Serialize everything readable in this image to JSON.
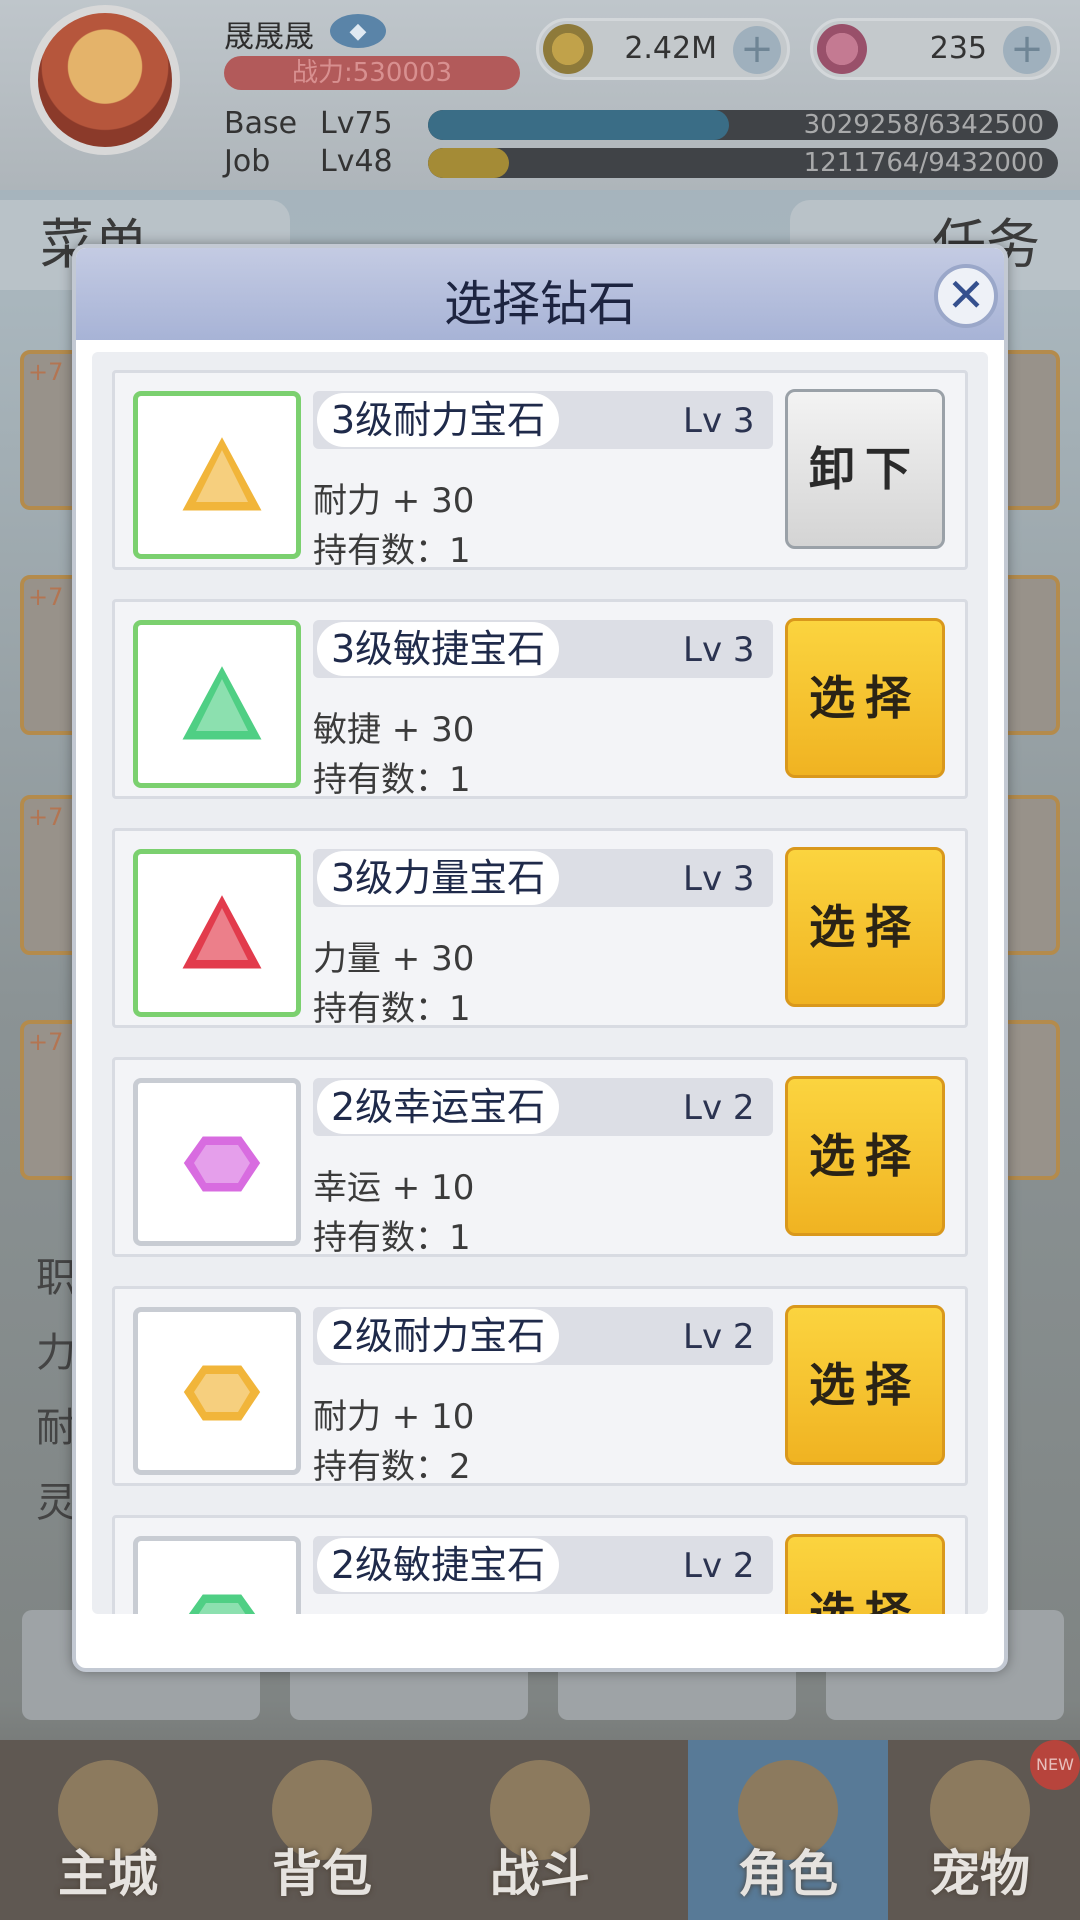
{
  "player": {
    "name": "晟晟晟",
    "power_label": "战力:530003",
    "base_label": "Base",
    "base_level": "Lv75",
    "base_exp": "3029258/6342500",
    "base_exp_fraction": 0.478,
    "job_label": "Job",
    "job_level": "Lv48",
    "job_exp": "1211764/9432000",
    "job_exp_fraction": 0.128
  },
  "currency": {
    "zeny": "2.42M",
    "gems": "235"
  },
  "background": {
    "tab_menu": "菜单",
    "tab_task": "任务",
    "card_plus": "+7",
    "stats": [
      "职",
      "力",
      "耐",
      "灵"
    ]
  },
  "modal": {
    "title": "选择钻石",
    "close_symbol": "✕"
  },
  "gems": [
    {
      "name": "3级耐力宝石",
      "level": "Lv 3",
      "stat": "耐力 + 30",
      "count": "持有数：1",
      "button": "卸下",
      "button_type": "unequip",
      "color": "#f1b53a",
      "shape": "triangle",
      "equipped": true
    },
    {
      "name": "3级敏捷宝石",
      "level": "Lv 3",
      "stat": "敏捷 + 30",
      "count": "持有数：1",
      "button": "选择",
      "button_type": "select",
      "color": "#4fcf84",
      "shape": "triangle",
      "equipped": true
    },
    {
      "name": "3级力量宝石",
      "level": "Lv 3",
      "stat": "力量 + 30",
      "count": "持有数：1",
      "button": "选择",
      "button_type": "select",
      "color": "#e23b4c",
      "shape": "triangle",
      "equipped": true
    },
    {
      "name": "2级幸运宝石",
      "level": "Lv 2",
      "stat": "幸运 + 10",
      "count": "持有数：1",
      "button": "选择",
      "button_type": "select",
      "color": "#d86ce0",
      "shape": "round",
      "equipped": false
    },
    {
      "name": "2级耐力宝石",
      "level": "Lv 2",
      "stat": "耐力 + 10",
      "count": "持有数：2",
      "button": "选择",
      "button_type": "select",
      "color": "#f1b53a",
      "shape": "round",
      "equipped": false
    },
    {
      "name": "2级敏捷宝石",
      "level": "Lv 2",
      "stat": "",
      "count": "",
      "button": "选择",
      "button_type": "select",
      "color": "#4fcf84",
      "shape": "round",
      "equipped": false
    }
  ],
  "nav": [
    {
      "label": "主城",
      "icon": "castle-icon"
    },
    {
      "label": "背包",
      "icon": "backpack-icon"
    },
    {
      "label": "战斗",
      "icon": "battle-icon"
    },
    {
      "label": "角色",
      "icon": "character-icon"
    },
    {
      "label": "宠物",
      "icon": "pet-icon"
    }
  ],
  "nav_badge": "NEW"
}
